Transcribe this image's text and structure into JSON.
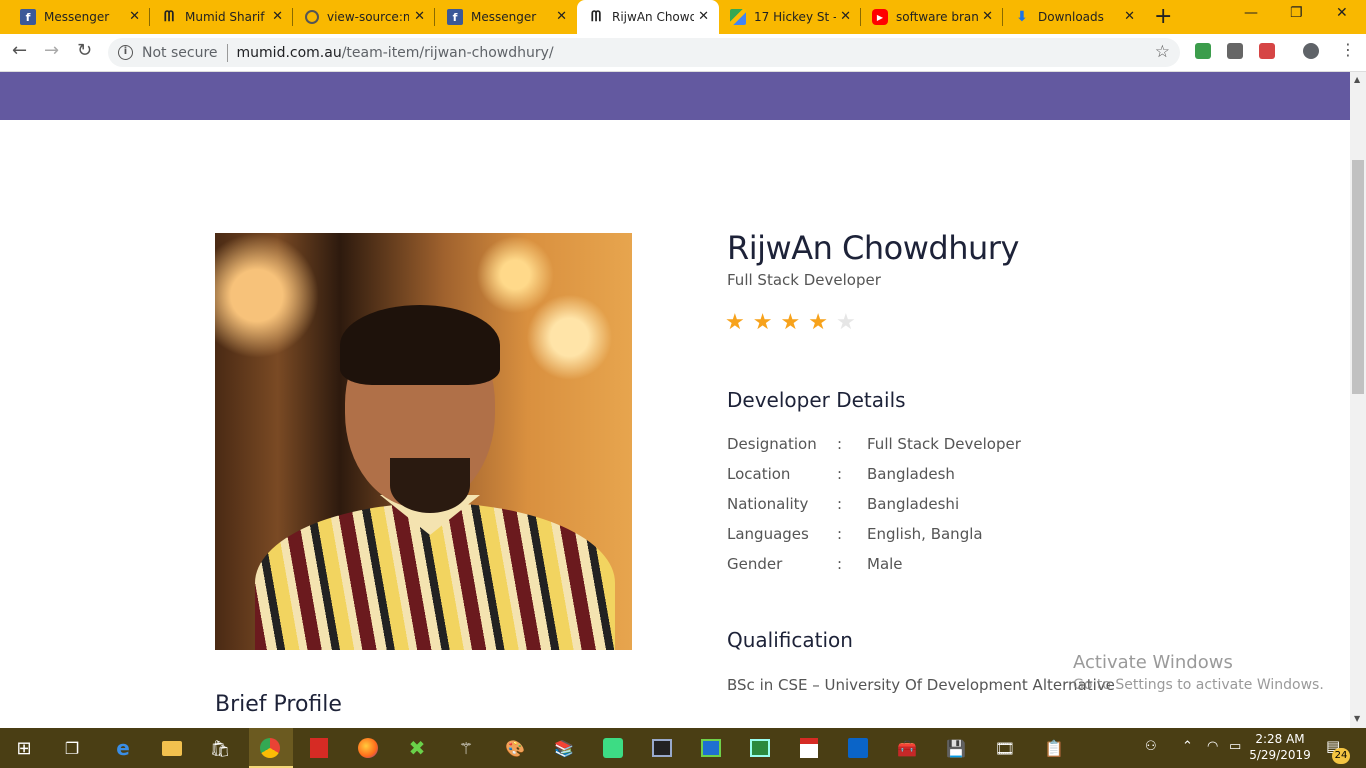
{
  "browser": {
    "tabs": [
      {
        "title": "Messenger",
        "icon": "facebook-icon",
        "active": false
      },
      {
        "title": "Mumid Sharif",
        "icon": "mumid-logo-icon",
        "active": false
      },
      {
        "title": "view-source:m",
        "icon": "globe-icon",
        "active": false
      },
      {
        "title": "Messenger",
        "icon": "facebook-icon",
        "active": false
      },
      {
        "title": "RijwAn Chowdh",
        "icon": "mumid-logo-icon",
        "active": true
      },
      {
        "title": "17 Hickey St - ",
        "icon": "google-maps-icon",
        "active": false
      },
      {
        "title": "software branc",
        "icon": "youtube-icon",
        "active": false
      },
      {
        "title": "Downloads",
        "icon": "download-icon",
        "active": false
      }
    ],
    "security_label": "Not secure",
    "url_host": "mumid.com.au",
    "url_path": "/team-item/rijwan-chowdhury/"
  },
  "profile": {
    "name": "RijwAn Chowdhury",
    "role": "Full Stack Developer",
    "rating": 4,
    "rating_max": 5,
    "details_heading": "Developer Details",
    "details": [
      {
        "label": "Designation",
        "value": "Full Stack Developer"
      },
      {
        "label": "Location",
        "value": "Bangladesh"
      },
      {
        "label": "Nationality",
        "value": "Bangladeshi"
      },
      {
        "label": "Languages",
        "value": " English, Bangla"
      },
      {
        "label": "Gender",
        "value": " Male"
      }
    ],
    "qualification_heading": "Qualification",
    "qualification": "BSc in CSE – University Of Development Alternative",
    "brief_heading": "Brief Profile"
  },
  "watermark": {
    "title": "Activate Windows",
    "subtitle": "Go to Settings to activate Windows."
  },
  "taskbar": {
    "time": "2:28 AM",
    "date": "5/29/2019",
    "notification_count": "24"
  },
  "colors": {
    "tabstrip": "#f9b800",
    "banner": "#6359a0",
    "star": "#f7a21b",
    "taskbar": "#4a3e14"
  }
}
